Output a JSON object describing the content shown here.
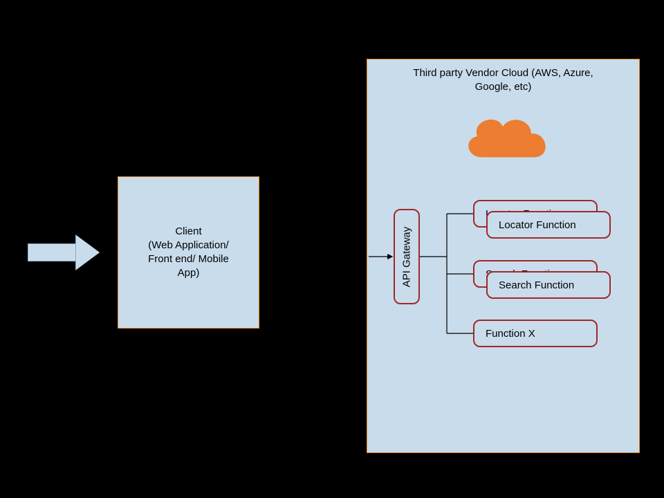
{
  "entryArrow": {
    "name": "entry-arrow"
  },
  "client": {
    "line1": "Client",
    "line2": "(Web Application/",
    "line3": "Front end/ Mobile",
    "line4": "App)"
  },
  "cloud": {
    "title_line1": "Third party Vendor Cloud (AWS, Azure,",
    "title_line2": "Google, etc)",
    "icon_name": "cloud-icon"
  },
  "apiGateway": {
    "label": "API Gateway"
  },
  "functions": {
    "locator_back_label": "Locator Function",
    "locator_front_label": "Locator Function",
    "search_back_label": "Search Function",
    "search_front_label": "Search Function",
    "function_x_label": "Function X"
  },
  "colors": {
    "panel_fill": "#c9dcec",
    "panel_border": "#e38b29",
    "fn_border": "#a02828",
    "cloud_fill": "#ed7d31"
  }
}
